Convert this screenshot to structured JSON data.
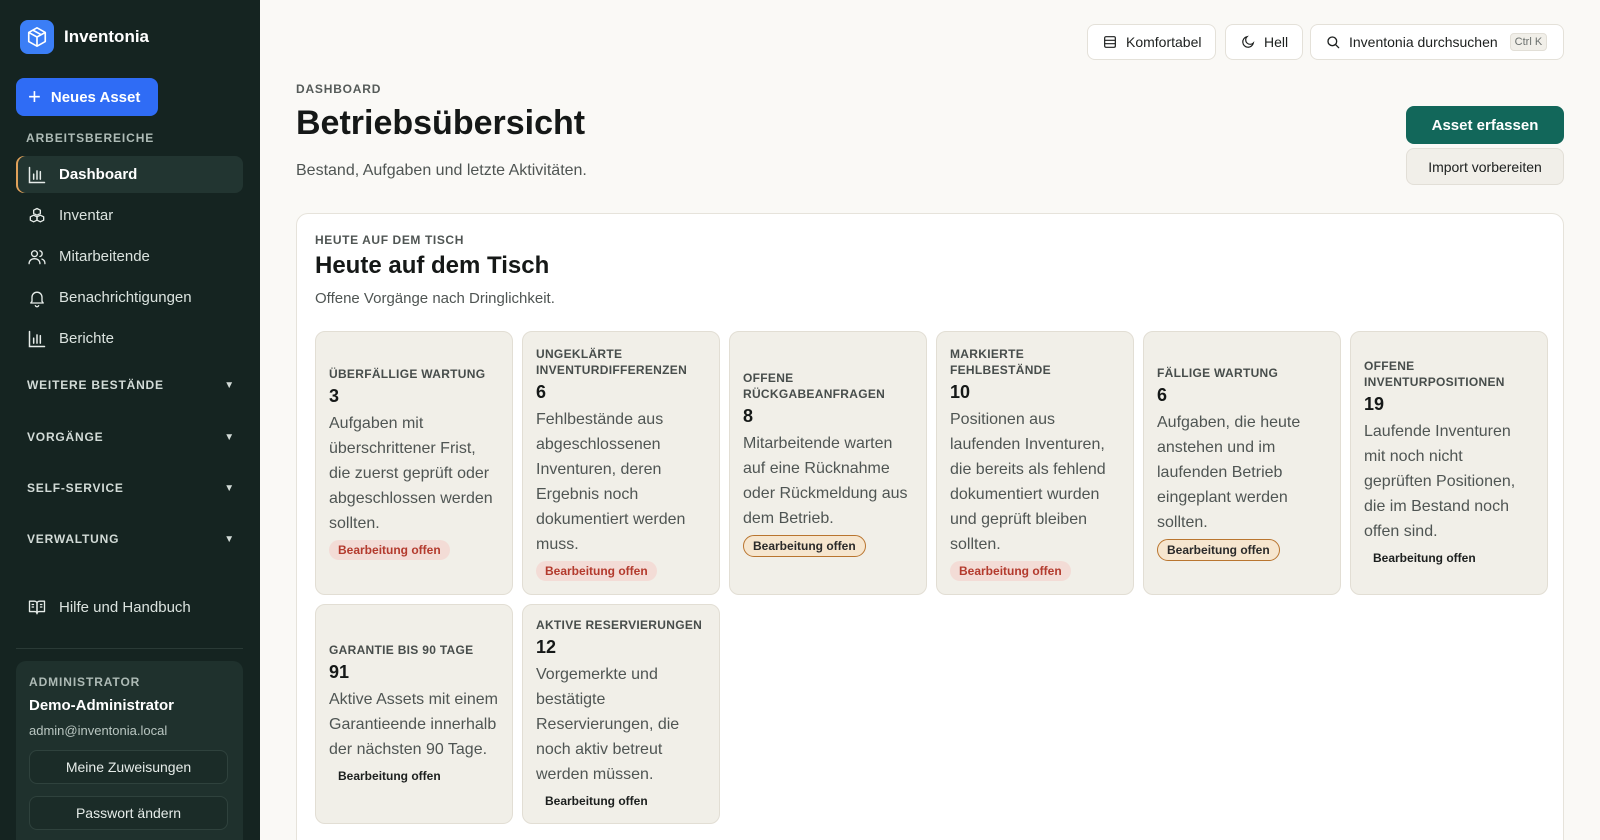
{
  "app": {
    "name": "Inventonia"
  },
  "sidebar": {
    "new_asset_label": "Neues Asset",
    "section_label": "ARBEITSBEREICHE",
    "items": [
      {
        "label": "Dashboard",
        "icon": "bar-chart-icon",
        "active": true
      },
      {
        "label": "Inventar",
        "icon": "boxes-icon"
      },
      {
        "label": "Mitarbeitende",
        "icon": "users-icon"
      },
      {
        "label": "Benachrichtigungen",
        "icon": "bell-icon"
      },
      {
        "label": "Berichte",
        "icon": "bar-chart-icon"
      }
    ],
    "groups": [
      {
        "label": "WEITERE BESTÄNDE"
      },
      {
        "label": "VORGÄNGE"
      },
      {
        "label": "SELF-SERVICE"
      },
      {
        "label": "VERWALTUNG"
      }
    ],
    "help_label": "Hilfe und Handbuch",
    "admin": {
      "role": "ADMINISTRATOR",
      "name": "Demo-Administrator",
      "email": "admin@inventonia.local",
      "assignments_label": "Meine Zuweisungen",
      "password_label": "Passwort ändern"
    }
  },
  "topbar": {
    "density_label": "Komfortabel",
    "theme_label": "Hell",
    "search_label": "Inventonia durchsuchen",
    "search_shortcut": "Ctrl K"
  },
  "header": {
    "breadcrumb": "DASHBOARD",
    "title": "Betriebsübersicht",
    "subtitle": "Bestand, Aufgaben und letzte Aktivitäten.",
    "primary_action": "Asset erfassen",
    "secondary_action": "Import vorbereiten"
  },
  "panel": {
    "eyebrow": "HEUTE AUF DEM TISCH",
    "title": "Heute auf dem Tisch",
    "subtitle": "Offene Vorgänge nach Dringlichkeit.",
    "cards": [
      {
        "label": "Überfällige Wartung",
        "value": "3",
        "desc": "Aufgaben mit überschrittener Frist, die zuerst geprüft oder abgeschlossen werden sollten.",
        "badge": "Bearbeitung offen",
        "tone": "red"
      },
      {
        "label": "Ungeklärte Inventurdifferenzen",
        "value": "6",
        "desc": "Fehlbestände aus abgeschlossenen Inventuren, deren Ergebnis noch dokumentiert werden muss.",
        "badge": "Bearbeitung offen",
        "tone": "red"
      },
      {
        "label": "Offene Rückgabeanfragen",
        "value": "8",
        "desc": "Mitarbeitende warten auf eine Rücknahme oder Rückmeldung aus dem Betrieb.",
        "badge": "Bearbeitung offen",
        "tone": "amber"
      },
      {
        "label": "Markierte Fehlbestände",
        "value": "10",
        "desc": "Positionen aus laufenden Inventuren, die bereits als fehlend dokumentiert wurden und geprüft bleiben sollten.",
        "badge": "Bearbeitung offen",
        "tone": "red"
      },
      {
        "label": "Fällige Wartung",
        "value": "6",
        "desc": "Aufgaben, die heute anstehen und im laufenden Betrieb eingeplant werden sollten.",
        "badge": "Bearbeitung offen",
        "tone": "amber"
      },
      {
        "label": "Offene Inventurpositionen",
        "value": "19",
        "desc": "Laufende Inventuren mit noch nicht geprüften Positionen, die im Bestand noch offen sind.",
        "badge": "Bearbeitung offen",
        "tone": "plain"
      },
      {
        "label": "Garantie bis 90 Tage",
        "value": "91",
        "desc": "Aktive Assets mit einem Garantieende innerhalb der nächsten 90 Tage.",
        "badge": "Bearbeitung offen",
        "tone": "plain"
      },
      {
        "label": "Aktive Reservierungen",
        "value": "12",
        "desc": "Vorgemerkte und bestätigte Reservierungen, die noch aktiv betreut werden müssen.",
        "badge": "Bearbeitung offen",
        "tone": "plain"
      }
    ]
  },
  "colors": {
    "sidebar_bg": "#152421",
    "accent_blue": "#2f6cf5",
    "primary_green": "#12675a",
    "active_indicator": "#e0a15a",
    "badge_red": "#b33a2d"
  }
}
